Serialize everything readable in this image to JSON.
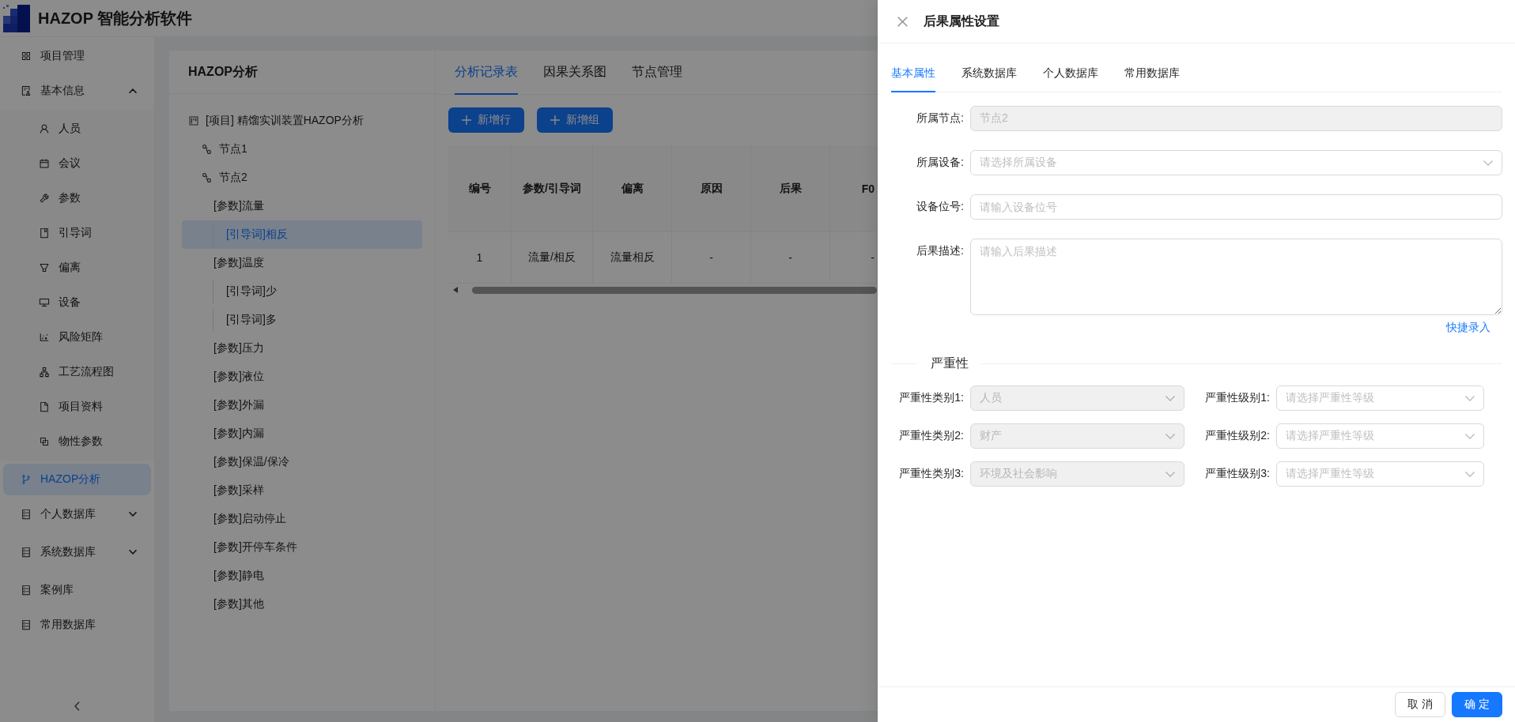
{
  "app_header": {
    "title": "HAZOP 智能分析软件"
  },
  "sidebar": {
    "items": [
      {
        "label": "项目管理",
        "selected": false
      },
      {
        "label": "基本信息",
        "selected": false,
        "expanded": true,
        "children": [
          {
            "label": "人员",
            "selected": false
          },
          {
            "label": "会议",
            "selected": false
          },
          {
            "label": "参数",
            "selected": false
          },
          {
            "label": "引导词",
            "selected": false
          },
          {
            "label": "偏离",
            "selected": false
          },
          {
            "label": "设备",
            "selected": false
          },
          {
            "label": "风险矩阵",
            "selected": false
          },
          {
            "label": "工艺流程图",
            "selected": false
          },
          {
            "label": "项目资料",
            "selected": false
          },
          {
            "label": "物性参数",
            "selected": false
          }
        ]
      },
      {
        "label": "HAZOP分析",
        "selected": true
      },
      {
        "label": "个人数据库",
        "selected": false,
        "expanded": false
      },
      {
        "label": "系统数据库",
        "selected": false,
        "expanded": false
      },
      {
        "label": "案例库",
        "selected": false
      },
      {
        "label": "常用数据库",
        "selected": false
      }
    ]
  },
  "tree_panel": {
    "title": "HAZOP分析",
    "tree": [
      {
        "kind": "project",
        "label": "[项目] 精馏实训装置HAZOP分析",
        "selected": false,
        "children": [
          {
            "kind": "node",
            "label": "节点1",
            "selected": false
          },
          {
            "kind": "node",
            "label": "节点2",
            "selected": false,
            "children": [
              {
                "kind": "parameter",
                "label": "[参数]流量",
                "selected": false,
                "children": [
                  {
                    "kind": "guide_word",
                    "label": "[引导词]相反",
                    "selected": true
                  }
                ]
              },
              {
                "kind": "parameter",
                "label": "[参数]温度",
                "selected": false,
                "children": [
                  {
                    "kind": "guide_word",
                    "label": "[引导词]少",
                    "selected": false
                  },
                  {
                    "kind": "guide_word",
                    "label": "[引导词]多",
                    "selected": false
                  }
                ]
              },
              {
                "kind": "parameter",
                "label": "[参数]压力",
                "selected": false
              },
              {
                "kind": "parameter",
                "label": "[参数]液位",
                "selected": false
              },
              {
                "kind": "parameter",
                "label": "[参数]外漏",
                "selected": false
              },
              {
                "kind": "parameter",
                "label": "[参数]内漏",
                "selected": false
              },
              {
                "kind": "parameter",
                "label": "[参数]保温/保冷",
                "selected": false
              },
              {
                "kind": "parameter",
                "label": "[参数]采样",
                "selected": false
              },
              {
                "kind": "parameter",
                "label": "[参数]启动停止",
                "selected": false
              },
              {
                "kind": "parameter",
                "label": "[参数]开停车条件",
                "selected": false
              },
              {
                "kind": "parameter",
                "label": "[参数]静电",
                "selected": false
              },
              {
                "kind": "parameter",
                "label": "[参数]其他",
                "selected": false
              }
            ]
          }
        ]
      }
    ]
  },
  "analysis_panel": {
    "tabs": [
      {
        "label": "分析记录表",
        "selected": true
      },
      {
        "label": "因果关系图",
        "selected": false
      },
      {
        "label": "节点管理",
        "selected": false
      }
    ],
    "buttons": [
      "新增行",
      "新增组"
    ],
    "table": {
      "columns": [
        "编号",
        "参数/引导词",
        "偏离",
        "原因",
        "后果",
        "F0"
      ],
      "rows": [
        [
          "1",
          "流量/相反",
          "流量相反",
          "-",
          "-",
          "-"
        ]
      ]
    }
  },
  "drawer": {
    "title": "后果属性设置",
    "tabs": [
      {
        "label": "基本属性",
        "selected": true
      },
      {
        "label": "系统数据库",
        "selected": false
      },
      {
        "label": "个人数据库",
        "selected": false
      },
      {
        "label": "常用数据库",
        "selected": false
      }
    ],
    "fields": [
      {
        "label": "所属节点:",
        "kind": "input",
        "disabled": true,
        "value": "节点2"
      },
      {
        "label": "所属设备:",
        "kind": "select",
        "disabled": false,
        "placeholder": "请选择所属设备"
      },
      {
        "label": "设备位号:",
        "kind": "input",
        "disabled": false,
        "placeholder": "请输入设备位号"
      },
      {
        "label": "后果描述:",
        "kind": "textarea",
        "disabled": false,
        "placeholder": "请输入后果描述"
      }
    ],
    "quick_entry_link": "快捷录入",
    "severity": {
      "title": "严重性",
      "rows": [
        {
          "category": {
            "label": "严重性类别1:",
            "disabled": true,
            "value": "人员"
          },
          "level": {
            "label": "严重性级别1:",
            "disabled": false,
            "placeholder": "请选择严重性等级"
          }
        },
        {
          "category": {
            "label": "严重性类别2:",
            "disabled": true,
            "value": "财产"
          },
          "level": {
            "label": "严重性级别2:",
            "disabled": false,
            "placeholder": "请选择严重性等级"
          }
        },
        {
          "category": {
            "label": "严重性类别3:",
            "disabled": true,
            "value": "环境及社会影响"
          },
          "level": {
            "label": "严重性级别3:",
            "disabled": false,
            "placeholder": "请选择严重性等级"
          }
        }
      ]
    },
    "footer_buttons": [
      {
        "label": "取 消",
        "kind": "default"
      },
      {
        "label": "确 定",
        "kind": "primary"
      }
    ]
  }
}
